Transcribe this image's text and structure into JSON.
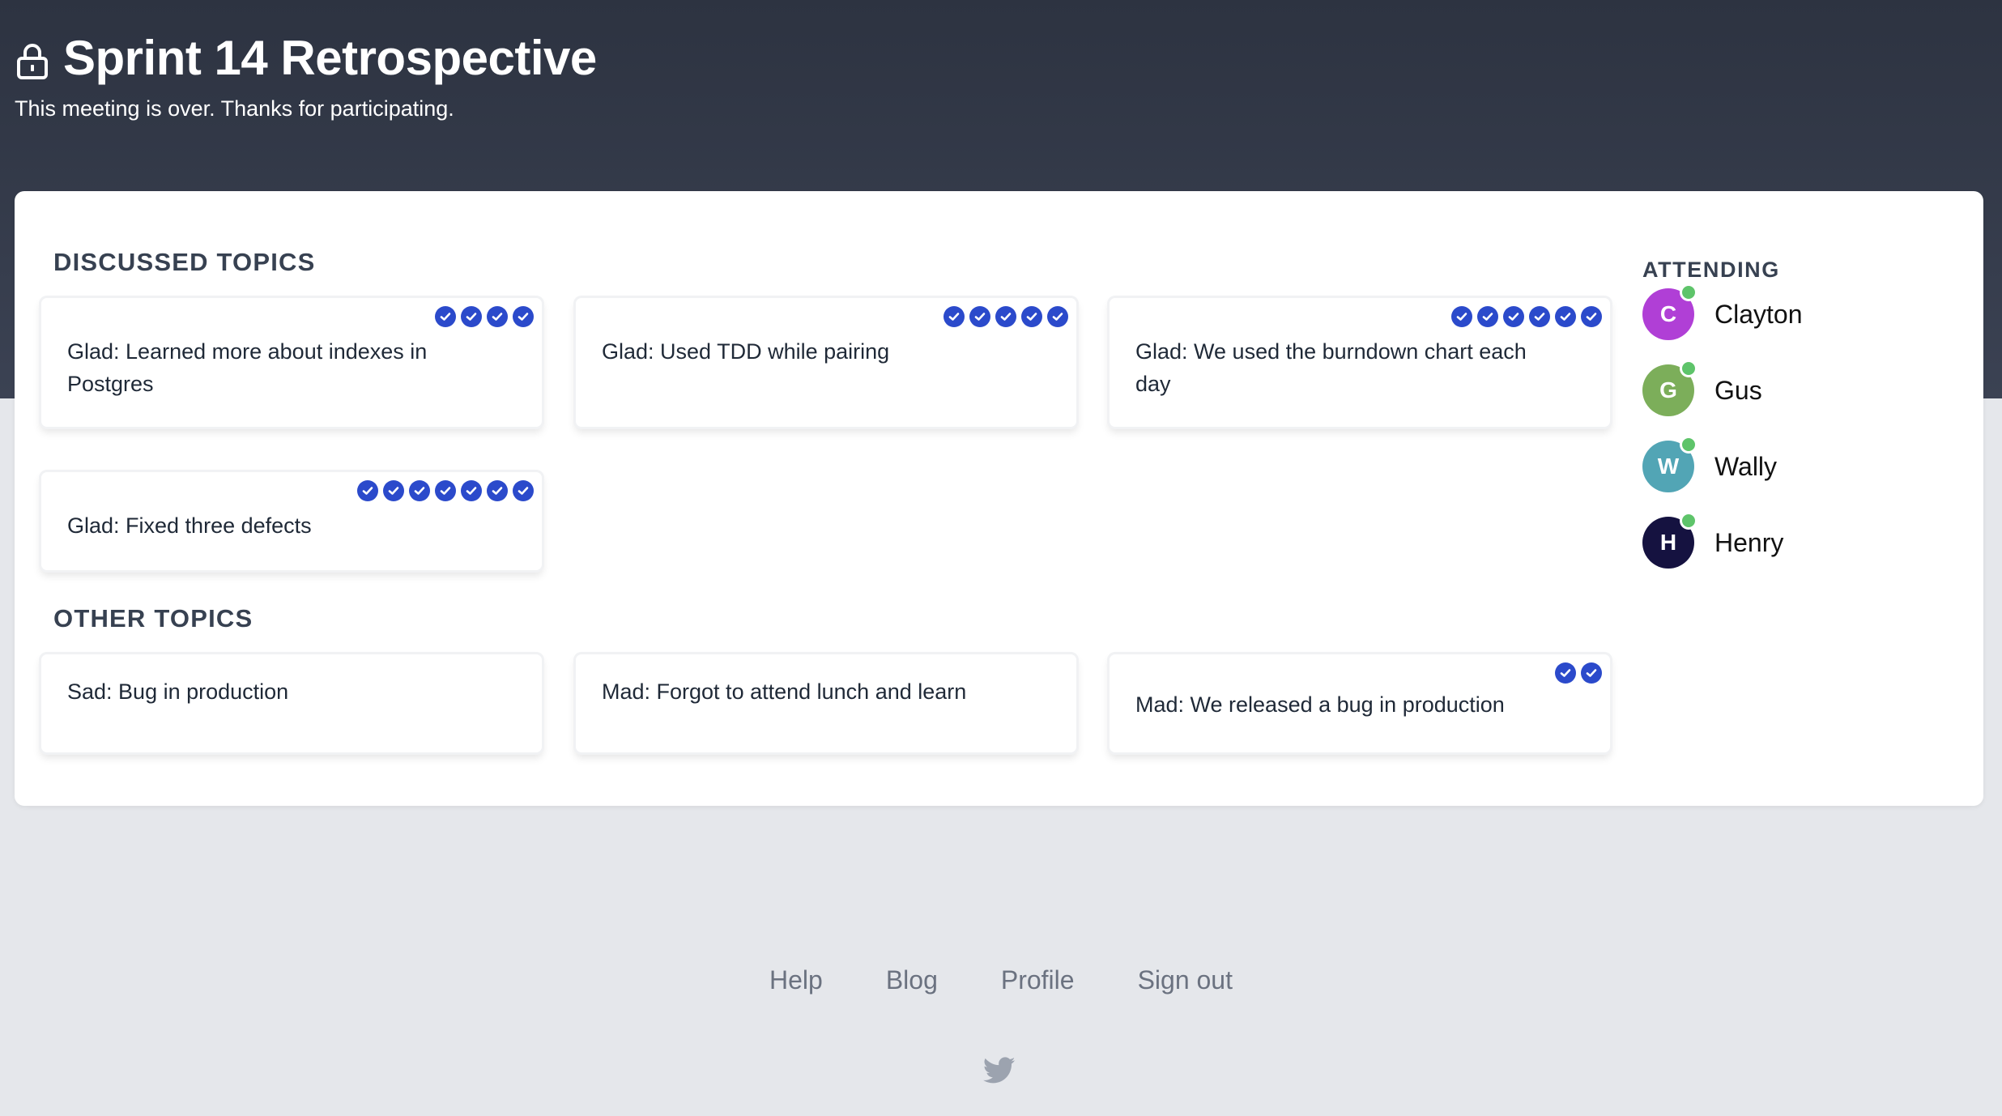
{
  "header": {
    "lock_icon": "lock-icon",
    "title": "Sprint 14 Retrospective",
    "subtitle": "This meeting is over. Thanks for participating."
  },
  "discussed": {
    "heading": "DISCUSSED TOPICS",
    "topics": [
      {
        "text": "Glad: Learned more about indexes in Postgres",
        "votes": 4
      },
      {
        "text": "Glad: Used TDD while pairing",
        "votes": 5
      },
      {
        "text": "Glad: We used the burndown chart each day",
        "votes": 6
      },
      {
        "text": "Glad: Fixed three defects",
        "votes": 7
      }
    ]
  },
  "other": {
    "heading": "OTHER TOPICS",
    "topics": [
      {
        "text": "Sad: Bug in production",
        "votes": 0
      },
      {
        "text": "Mad: Forgot to attend lunch and learn",
        "votes": 0
      },
      {
        "text": "Mad: We released a bug in production",
        "votes": 2
      }
    ]
  },
  "attending": {
    "heading": "ATTENDING",
    "people": [
      {
        "initial": "C",
        "name": "Clayton",
        "color": "#b03fd6",
        "online": true
      },
      {
        "initial": "G",
        "name": "Gus",
        "color": "#7cae5a",
        "online": true
      },
      {
        "initial": "W",
        "name": "Wally",
        "color": "#52a5b5",
        "online": true
      },
      {
        "initial": "H",
        "name": "Henry",
        "color": "#151240",
        "online": true
      }
    ]
  },
  "footer": {
    "links": [
      "Help",
      "Blog",
      "Profile",
      "Sign out"
    ],
    "social_icon": "twitter-icon"
  },
  "colors": {
    "vote": "#2b4acb",
    "online": "#5ec46a",
    "header_bg": "#343a4a"
  }
}
